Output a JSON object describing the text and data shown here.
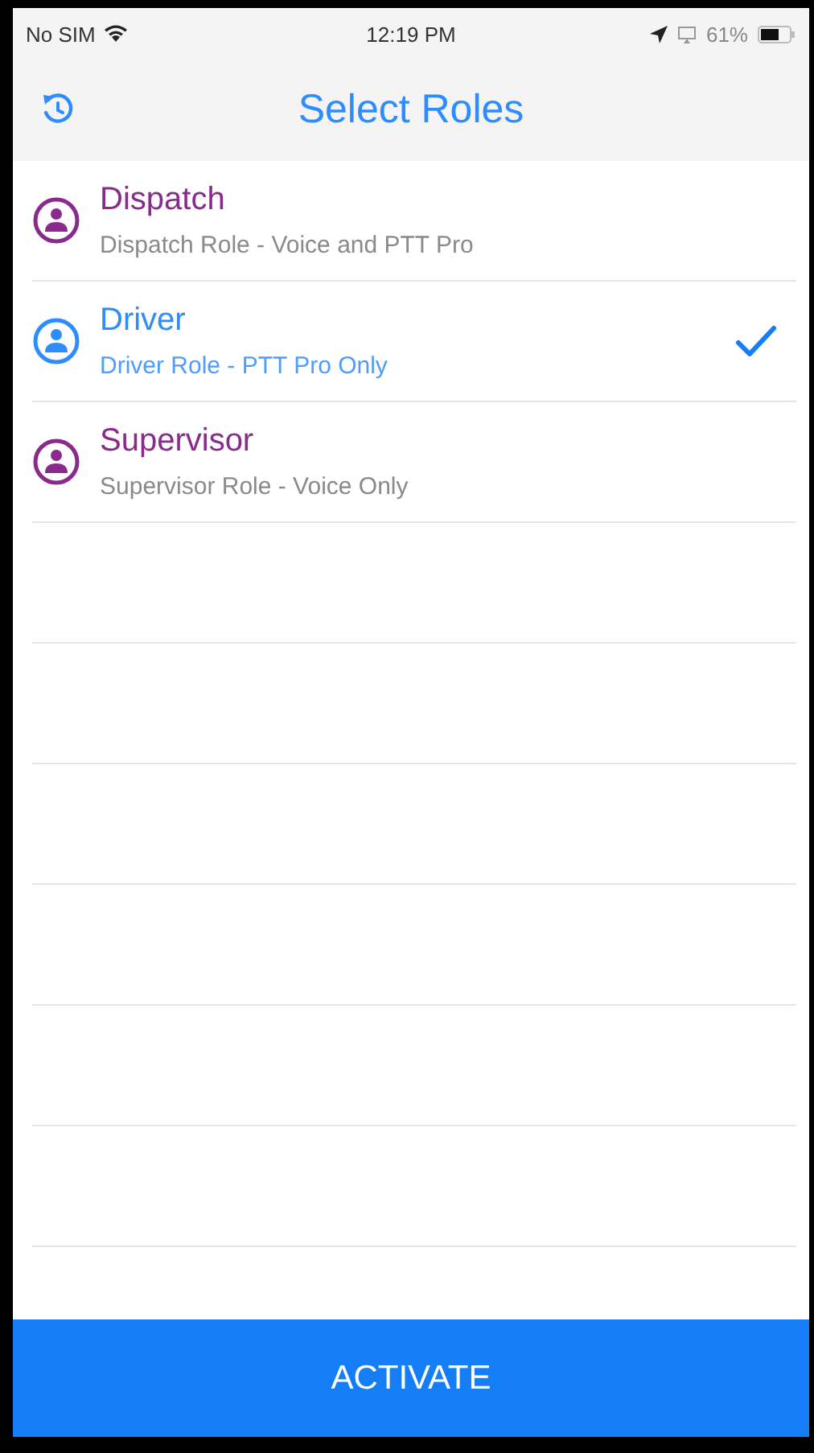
{
  "status_bar": {
    "carrier": "No SIM",
    "time": "12:19 PM",
    "battery": "61%"
  },
  "nav_bar": {
    "title": "Select Roles"
  },
  "roles": [
    {
      "name": "Dispatch",
      "description": "Dispatch Role - Voice and PTT Pro",
      "selected": false
    },
    {
      "name": "Driver",
      "description": "Driver Role - PTT Pro Only",
      "selected": true
    },
    {
      "name": "Supervisor",
      "description": "Supervisor Role - Voice Only",
      "selected": false
    }
  ],
  "action_button": "ACTIVATE"
}
